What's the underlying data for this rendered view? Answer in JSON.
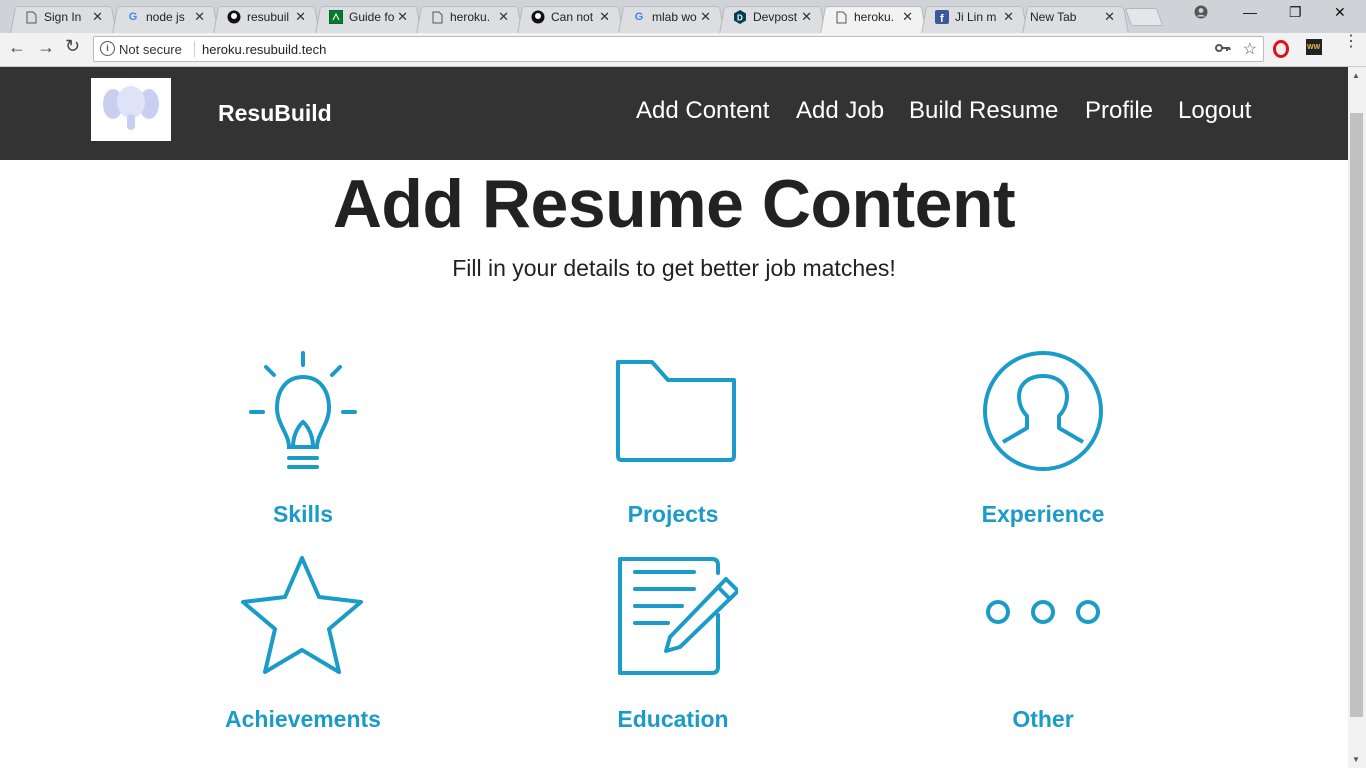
{
  "browser": {
    "tabs": [
      {
        "title": "Sign In",
        "icon": "page-icon"
      },
      {
        "title": "node js",
        "icon": "google-icon"
      },
      {
        "title": "resubuil",
        "icon": "github-icon"
      },
      {
        "title": "Guide fo",
        "icon": "guide-icon"
      },
      {
        "title": "heroku.",
        "icon": "page-icon"
      },
      {
        "title": "Can not",
        "icon": "github-icon"
      },
      {
        "title": "mlab wo",
        "icon": "google-icon"
      },
      {
        "title": "Devpost",
        "icon": "devpost-icon"
      },
      {
        "title": "heroku.",
        "icon": "page-icon",
        "active": true
      },
      {
        "title": "Ji Lin m",
        "icon": "facebook-icon"
      },
      {
        "title": "New Tab",
        "icon": ""
      }
    ],
    "security_label": "Not secure",
    "url": "heroku.resubuild.tech"
  },
  "navbar": {
    "logo_text": "Resu Build",
    "brand": "ResuBuild",
    "links": [
      "Add Content",
      "Add Job",
      "Build Resume",
      "Profile",
      "Logout"
    ]
  },
  "main": {
    "title": "Add Resume Content",
    "subtitle": "Fill in your details to get better job matches!",
    "cards": [
      {
        "label": "Skills",
        "icon": "lightbulb-icon"
      },
      {
        "label": "Projects",
        "icon": "folder-icon"
      },
      {
        "label": "Experience",
        "icon": "user-circle-icon"
      },
      {
        "label": "Achievements",
        "icon": "star-icon"
      },
      {
        "label": "Education",
        "icon": "document-edit-icon"
      },
      {
        "label": "Other",
        "icon": "ellipsis-icon"
      }
    ]
  },
  "colors": {
    "accent": "#1a9bc8",
    "navbar_bg": "#333333",
    "heading": "#222222"
  }
}
